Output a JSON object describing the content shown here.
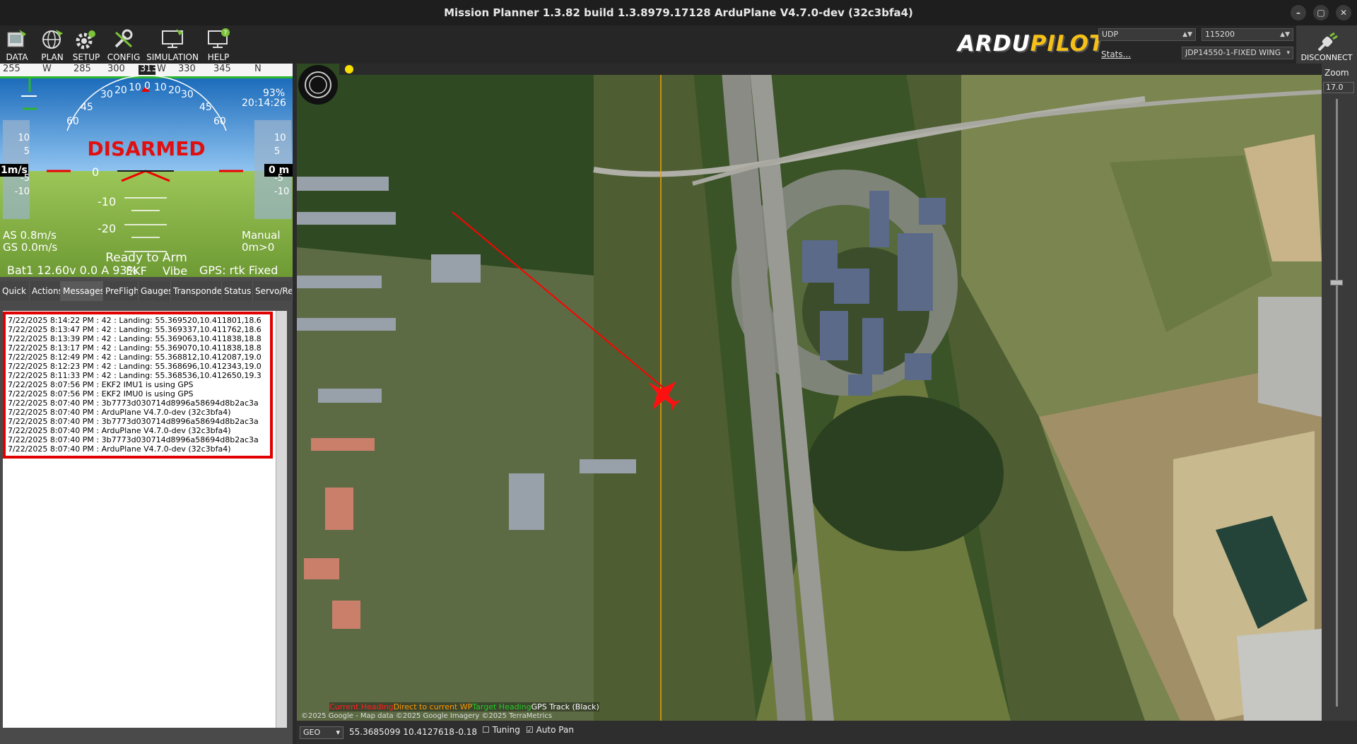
{
  "window": {
    "title": "Mission Planner 1.3.82 build 1.3.8979.17128 ArduPlane V4.7.0-dev (32c3bfa4)",
    "btn_min": "–",
    "btn_max": "▢",
    "btn_close": "✕"
  },
  "toolbar": {
    "items": [
      {
        "label": "DATA",
        "icon": "data-icon"
      },
      {
        "label": "PLAN",
        "icon": "plan-globe-icon"
      },
      {
        "label": "SETUP",
        "icon": "setup-gear-icon"
      },
      {
        "label": "CONFIG",
        "icon": "config-wrench-icon"
      },
      {
        "label": "SIMULATION",
        "icon": "simulation-monitor-icon"
      },
      {
        "label": "HELP",
        "icon": "help-monitor-icon"
      }
    ],
    "logo_ardu": "ARDU",
    "logo_pilot": "PILOT",
    "connection_type": "UDP",
    "baud_rate": "115200",
    "stats_link": "Stats...",
    "vehicle_profile": "JDP14550-1-FIXED WING",
    "disconnect_label": "DISCONNECT"
  },
  "hud": {
    "compass_labels": [
      "255",
      "W",
      "285",
      "300",
      "313",
      "W",
      "330",
      "345",
      "N"
    ],
    "mode_status": "DISARMED",
    "pitch_labels": [
      "10",
      "5",
      "0",
      "-5",
      "-10",
      "-20"
    ],
    "roll_labels": [
      "60",
      "45",
      "30",
      "20",
      "10",
      "0",
      "10",
      "20",
      "30",
      "45",
      "60"
    ],
    "speed_scale": [
      "10",
      "5",
      "0",
      "-5",
      "-10"
    ],
    "alt_scale": [
      "10",
      "5",
      "0",
      "-5",
      "-10"
    ],
    "speed_value": "1m/s",
    "alt_value": "0 m",
    "battery_percent": "93%",
    "time": "20:14:26",
    "airspeed": "AS 0.8m/s",
    "groundspeed": "GS 0.0m/s",
    "flight_mode": "Manual",
    "distance": "0m>0",
    "arm_status": "Ready to Arm",
    "battery": "Bat1 12.60v 0.0 A 93%",
    "ekf": "EKF",
    "vibe": "Vibe",
    "gps": "GPS: rtk Fixed"
  },
  "tabs": [
    "Quick",
    "Actions",
    "Messages",
    "PreFlight",
    "Gauges",
    "Transponder",
    "Status",
    "Servo/Re"
  ],
  "active_tab": "Messages",
  "messages": [
    "7/22/2025 8:14:22 PM : 42 : Landing: 55.369520,10.411801,18.6",
    "7/22/2025 8:13:47 PM : 42 : Landing: 55.369337,10.411762,18.6",
    "7/22/2025 8:13:39 PM : 42 : Landing: 55.369063,10.411838,18.8",
    "7/22/2025 8:13:17 PM : 42 : Landing: 55.369070,10.411838,18.8",
    "7/22/2025 8:12:49 PM : 42 : Landing: 55.368812,10.412087,19.0",
    "7/22/2025 8:12:23 PM : 42 : Landing: 55.368696,10.412343,19.0",
    "7/22/2025 8:11:33 PM : 42 : Landing: 55.368536,10.412650,19.3",
    "7/22/2025 8:07:56 PM : EKF2 IMU1 is using GPS",
    "7/22/2025 8:07:56 PM : EKF2 IMU0 is using GPS",
    "7/22/2025 8:07:40 PM : 3b7773d030714d8996a58694d8b2ac3a",
    "7/22/2025 8:07:40 PM : ArduPlane V4.7.0-dev (32c3bfa4)",
    "7/22/2025 8:07:40 PM : 3b7773d030714d8996a58694d8b2ac3a",
    "7/22/2025 8:07:40 PM : ArduPlane V4.7.0-dev (32c3bfa4)",
    "7/22/2025 8:07:40 PM : 3b7773d030714d8996a58694d8b2ac3a",
    "7/22/2025 8:07:40 PM : ArduPlane V4.7.0-dev (32c3bfa4)"
  ],
  "map": {
    "legend_current_heading": "Current Heading",
    "legend_direct": "Direct to current WP",
    "legend_target": "Target Heading",
    "legend_gps_track": "GPS Track (Black)",
    "copyright": "©2025 Google - Map data ©2025 Google Imagery ©2025 TerraMetrics",
    "zoom_label": "Zoom",
    "zoom_value": "17.0",
    "colors": {
      "current_heading": "#ff0000",
      "direct": "#ff8c00",
      "target": "#00c000"
    }
  },
  "statusbar": {
    "coord_system": "GEO",
    "coords": "55.3685099 10.4127618",
    "alt": "-0.18",
    "tuning_label": "Tuning",
    "tuning_checked": "☐",
    "autopan_label": "Auto Pan",
    "autopan_checked": "☑"
  }
}
